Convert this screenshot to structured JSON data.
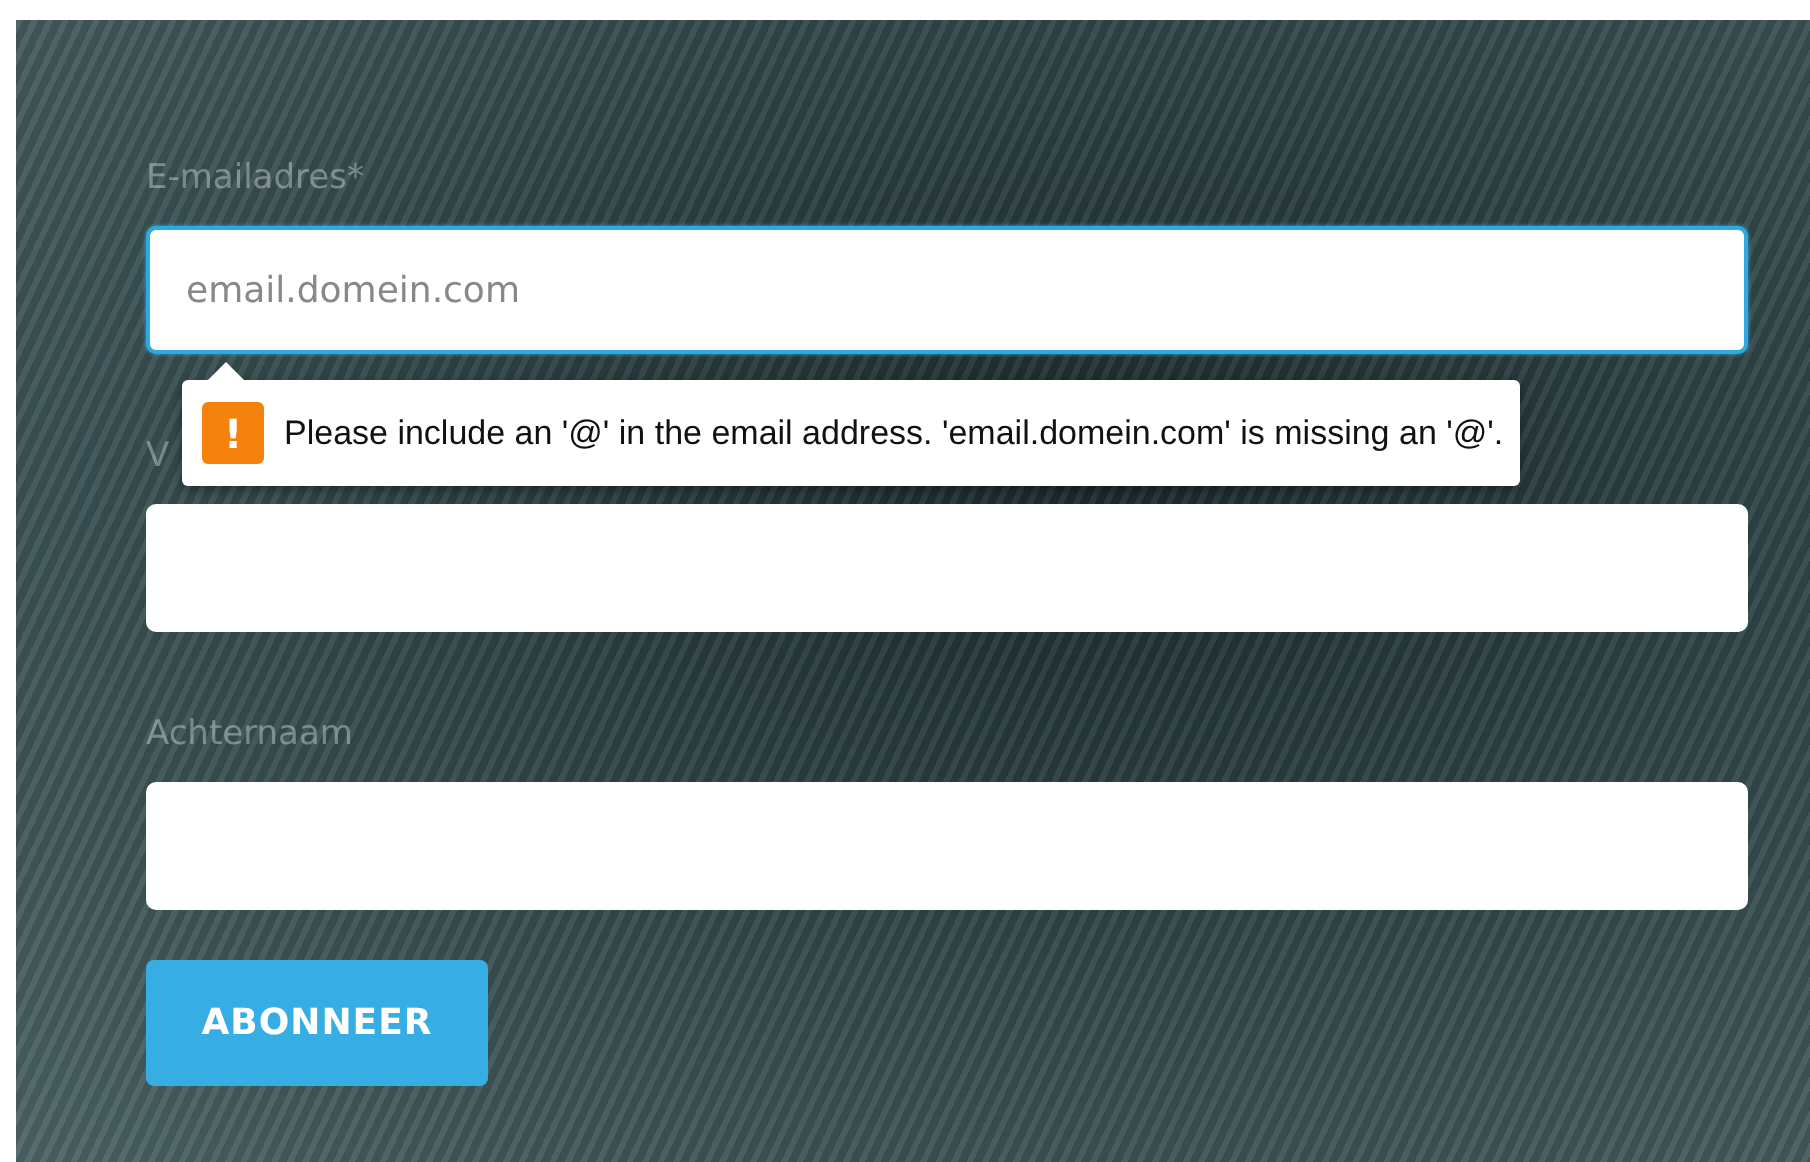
{
  "form": {
    "fields": [
      {
        "label": "E-mailadres*",
        "value": "email.domein.com",
        "focused": true
      },
      {
        "label": "V",
        "focused": false
      },
      {
        "label": "Achternaam",
        "focused": false
      }
    ],
    "validation_tooltip": {
      "icon": "!",
      "message": "Please include an '@' in the email address. 'email.domein.com' is missing an '@'."
    },
    "submit_button": "ABONNEER"
  }
}
